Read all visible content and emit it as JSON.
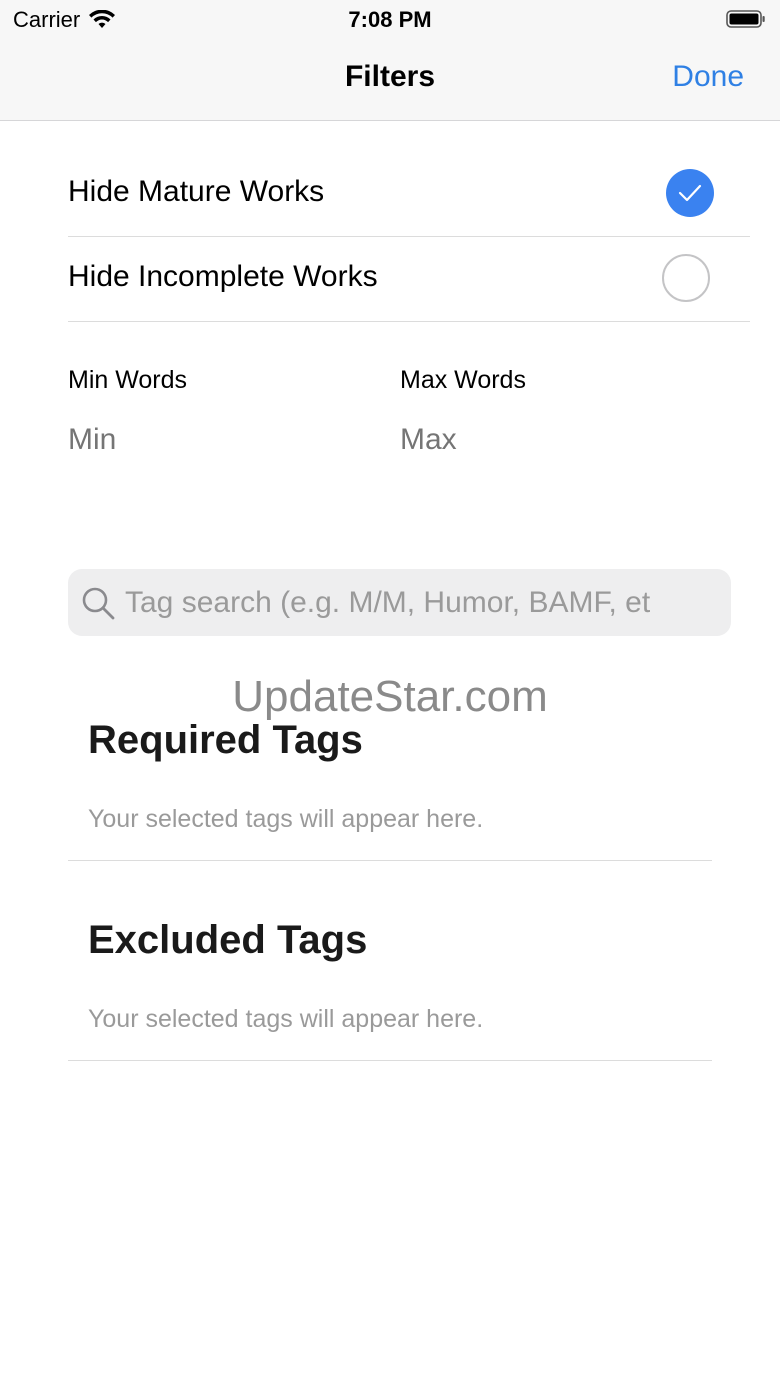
{
  "status_bar": {
    "carrier": "Carrier",
    "time": "7:08 PM"
  },
  "nav": {
    "title": "Filters",
    "done_label": "Done"
  },
  "toggles": [
    {
      "label": "Hide Mature Works",
      "checked": true
    },
    {
      "label": "Hide Incomplete Works",
      "checked": false
    }
  ],
  "words": {
    "min_label": "Min Words",
    "min_placeholder": "Min",
    "max_label": "Max Words",
    "max_placeholder": "Max"
  },
  "search": {
    "placeholder": "Tag search (e.g. M/M, Humor, BAMF, et"
  },
  "watermark": "UpdateStar.com",
  "required": {
    "title": "Required Tags",
    "hint": "Your selected tags will appear here."
  },
  "excluded": {
    "title": "Excluded Tags",
    "hint": "Your selected tags will appear here."
  },
  "colors": {
    "accent": "#2f80e4",
    "check_on": "#3a82f0",
    "placeholder": "#9a9a9a"
  }
}
